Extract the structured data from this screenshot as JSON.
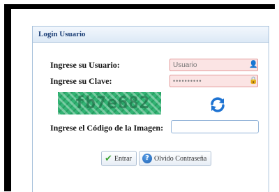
{
  "panel": {
    "title": "Login Usuario"
  },
  "form": {
    "usuario_label": "Ingrese su Usuario:",
    "usuario_placeholder": "Usuario",
    "clave_label": "Ingrese su Clave:",
    "clave_value": "••••••••••",
    "captcha_text": "fb7e682",
    "codigo_label": "Ingrese el Código de la Imagen:",
    "codigo_value": ""
  },
  "buttons": {
    "entrar": "Entrar",
    "olvido": "Olvido Contraseña"
  },
  "colors": {
    "header_text": "#1a3d75",
    "field_error_bg": "#fbe4e4",
    "field_error_border": "#e39a9a",
    "captcha_bg": "#33b374",
    "refresh_blue": "#1e73d2",
    "ok_green": "#3fa535"
  },
  "icons": {
    "usuario": "user-icon",
    "clave": "lock-icon",
    "refresh": "refresh-icon",
    "entrar": "checkmark-icon",
    "olvido": "help-icon"
  }
}
